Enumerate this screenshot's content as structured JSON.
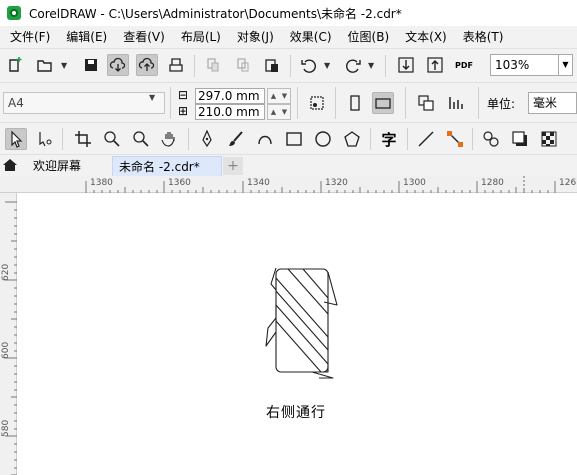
{
  "window": {
    "title": "CorelDRAW - C:\\Users\\Administrator\\Documents\\未命名 -2.cdr*"
  },
  "menu": {
    "items": [
      "文件(F)",
      "编辑(E)",
      "查看(V)",
      "布局(L)",
      "对象(J)",
      "效果(C)",
      "位图(B)",
      "文本(X)",
      "表格(T)"
    ]
  },
  "toolbar": {
    "zoom": "103%",
    "pdf_label": "PDF"
  },
  "property_bar": {
    "page_size": "A4",
    "width": "297.0 mm",
    "height": "210.0 mm",
    "units_label": "单位:",
    "units_value": "毫米"
  },
  "toolbox": {
    "text_tool_glyph": "字"
  },
  "tabs": {
    "welcome": "欢迎屏幕",
    "document": "未命名 -2.cdr*",
    "add": "+"
  },
  "rulers": {
    "horizontal": [
      "1380",
      "1360",
      "1340",
      "1320",
      "1300",
      "1280",
      "126"
    ],
    "vertical": [
      "620",
      "600",
      "580"
    ]
  },
  "canvas": {
    "caption": "右侧通行"
  },
  "colors": {
    "accent_tab": "#dde8fb",
    "app_logo": "#1fa142"
  }
}
